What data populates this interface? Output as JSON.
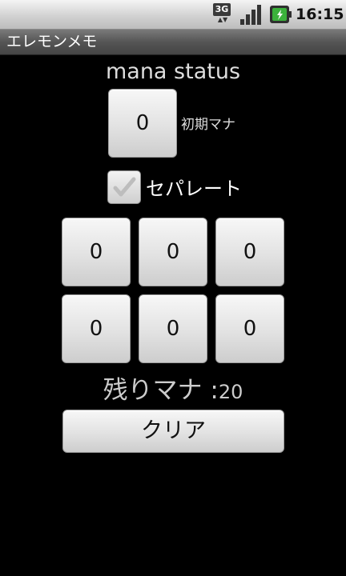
{
  "status_bar": {
    "network_type": "3G",
    "time": "16:15",
    "icons": [
      "3g-data-icon",
      "signal-strength-icon",
      "battery-icon"
    ]
  },
  "app": {
    "title": "エレモンメモ"
  },
  "main": {
    "heading": "mana status",
    "initial_mana": {
      "value": "0",
      "label": "初期マナ"
    },
    "separate": {
      "label": "セパレート",
      "checked": true
    },
    "mana_grid": [
      "0",
      "0",
      "0",
      "0",
      "0",
      "0"
    ],
    "remaining": {
      "label": "残りマナ :",
      "value": "20"
    },
    "clear_label": "クリア"
  },
  "colors": {
    "background": "#000000",
    "button_face": "#e2e2e2",
    "status_bar": "#d0d0d0",
    "title_bar": "#555555",
    "battery_green": "#3bb13b"
  }
}
